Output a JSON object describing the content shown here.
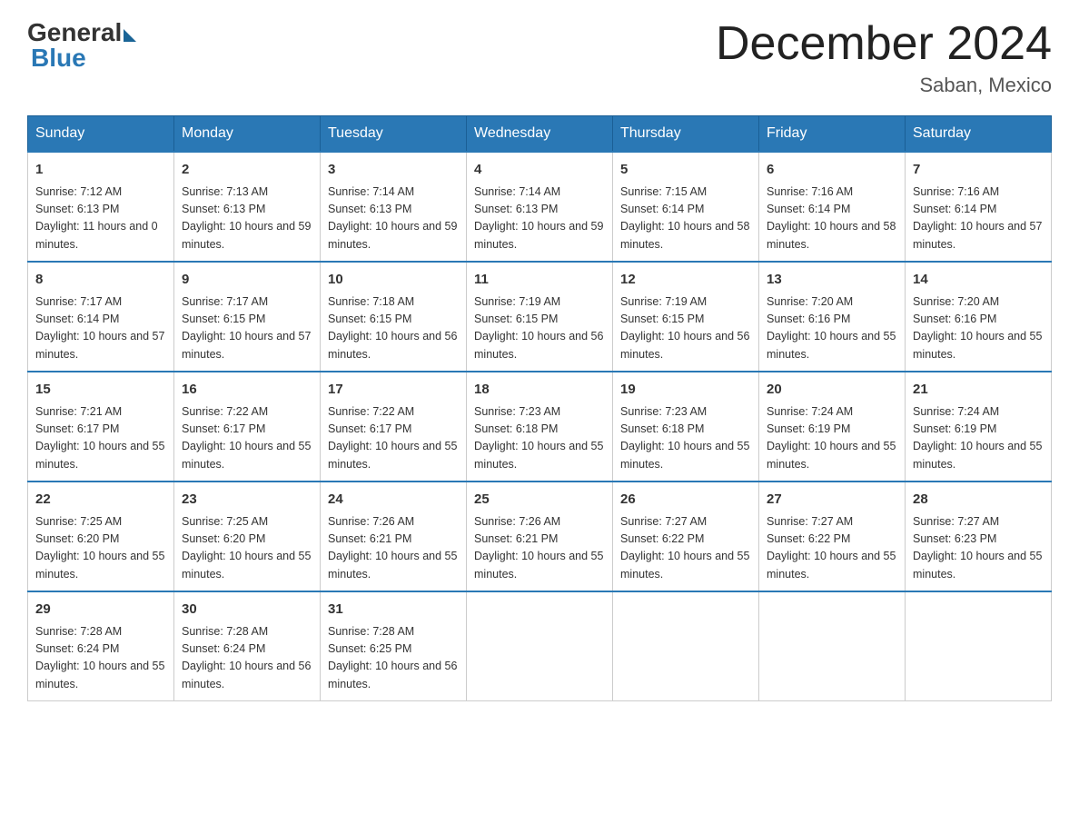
{
  "logo": {
    "general": "General",
    "blue": "Blue"
  },
  "title": "December 2024",
  "location": "Saban, Mexico",
  "days_of_week": [
    "Sunday",
    "Monday",
    "Tuesday",
    "Wednesday",
    "Thursday",
    "Friday",
    "Saturday"
  ],
  "weeks": [
    [
      {
        "day": "1",
        "sunrise": "7:12 AM",
        "sunset": "6:13 PM",
        "daylight": "11 hours and 0 minutes."
      },
      {
        "day": "2",
        "sunrise": "7:13 AM",
        "sunset": "6:13 PM",
        "daylight": "10 hours and 59 minutes."
      },
      {
        "day": "3",
        "sunrise": "7:14 AM",
        "sunset": "6:13 PM",
        "daylight": "10 hours and 59 minutes."
      },
      {
        "day": "4",
        "sunrise": "7:14 AM",
        "sunset": "6:13 PM",
        "daylight": "10 hours and 59 minutes."
      },
      {
        "day": "5",
        "sunrise": "7:15 AM",
        "sunset": "6:14 PM",
        "daylight": "10 hours and 58 minutes."
      },
      {
        "day": "6",
        "sunrise": "7:16 AM",
        "sunset": "6:14 PM",
        "daylight": "10 hours and 58 minutes."
      },
      {
        "day": "7",
        "sunrise": "7:16 AM",
        "sunset": "6:14 PM",
        "daylight": "10 hours and 57 minutes."
      }
    ],
    [
      {
        "day": "8",
        "sunrise": "7:17 AM",
        "sunset": "6:14 PM",
        "daylight": "10 hours and 57 minutes."
      },
      {
        "day": "9",
        "sunrise": "7:17 AM",
        "sunset": "6:15 PM",
        "daylight": "10 hours and 57 minutes."
      },
      {
        "day": "10",
        "sunrise": "7:18 AM",
        "sunset": "6:15 PM",
        "daylight": "10 hours and 56 minutes."
      },
      {
        "day": "11",
        "sunrise": "7:19 AM",
        "sunset": "6:15 PM",
        "daylight": "10 hours and 56 minutes."
      },
      {
        "day": "12",
        "sunrise": "7:19 AM",
        "sunset": "6:15 PM",
        "daylight": "10 hours and 56 minutes."
      },
      {
        "day": "13",
        "sunrise": "7:20 AM",
        "sunset": "6:16 PM",
        "daylight": "10 hours and 55 minutes."
      },
      {
        "day": "14",
        "sunrise": "7:20 AM",
        "sunset": "6:16 PM",
        "daylight": "10 hours and 55 minutes."
      }
    ],
    [
      {
        "day": "15",
        "sunrise": "7:21 AM",
        "sunset": "6:17 PM",
        "daylight": "10 hours and 55 minutes."
      },
      {
        "day": "16",
        "sunrise": "7:22 AM",
        "sunset": "6:17 PM",
        "daylight": "10 hours and 55 minutes."
      },
      {
        "day": "17",
        "sunrise": "7:22 AM",
        "sunset": "6:17 PM",
        "daylight": "10 hours and 55 minutes."
      },
      {
        "day": "18",
        "sunrise": "7:23 AM",
        "sunset": "6:18 PM",
        "daylight": "10 hours and 55 minutes."
      },
      {
        "day": "19",
        "sunrise": "7:23 AM",
        "sunset": "6:18 PM",
        "daylight": "10 hours and 55 minutes."
      },
      {
        "day": "20",
        "sunrise": "7:24 AM",
        "sunset": "6:19 PM",
        "daylight": "10 hours and 55 minutes."
      },
      {
        "day": "21",
        "sunrise": "7:24 AM",
        "sunset": "6:19 PM",
        "daylight": "10 hours and 55 minutes."
      }
    ],
    [
      {
        "day": "22",
        "sunrise": "7:25 AM",
        "sunset": "6:20 PM",
        "daylight": "10 hours and 55 minutes."
      },
      {
        "day": "23",
        "sunrise": "7:25 AM",
        "sunset": "6:20 PM",
        "daylight": "10 hours and 55 minutes."
      },
      {
        "day": "24",
        "sunrise": "7:26 AM",
        "sunset": "6:21 PM",
        "daylight": "10 hours and 55 minutes."
      },
      {
        "day": "25",
        "sunrise": "7:26 AM",
        "sunset": "6:21 PM",
        "daylight": "10 hours and 55 minutes."
      },
      {
        "day": "26",
        "sunrise": "7:27 AM",
        "sunset": "6:22 PM",
        "daylight": "10 hours and 55 minutes."
      },
      {
        "day": "27",
        "sunrise": "7:27 AM",
        "sunset": "6:22 PM",
        "daylight": "10 hours and 55 minutes."
      },
      {
        "day": "28",
        "sunrise": "7:27 AM",
        "sunset": "6:23 PM",
        "daylight": "10 hours and 55 minutes."
      }
    ],
    [
      {
        "day": "29",
        "sunrise": "7:28 AM",
        "sunset": "6:24 PM",
        "daylight": "10 hours and 55 minutes."
      },
      {
        "day": "30",
        "sunrise": "7:28 AM",
        "sunset": "6:24 PM",
        "daylight": "10 hours and 56 minutes."
      },
      {
        "day": "31",
        "sunrise": "7:28 AM",
        "sunset": "6:25 PM",
        "daylight": "10 hours and 56 minutes."
      },
      null,
      null,
      null,
      null
    ]
  ]
}
